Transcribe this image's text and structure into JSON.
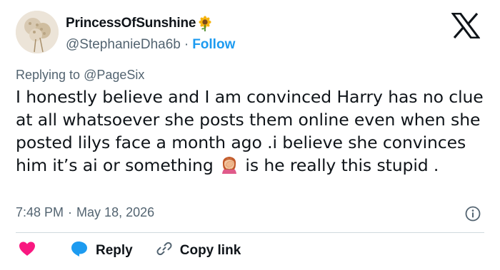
{
  "author": {
    "display_name": "PrincessOfSunshine",
    "handle": "@StephanieDha6b",
    "separator": "·",
    "follow_label": "Follow"
  },
  "reply_context": {
    "prefix": "Replying to",
    "mention": "@PageSix"
  },
  "tweet": {
    "text_part1": "I honestly believe and I am convinced Harry has no clue at all whatsoever she posts them online even when she posted lilys face a month ago .i believe she convinces him it’s ai or something",
    "text_part2": "is he really this stupid ."
  },
  "meta": {
    "time": "7:48 PM",
    "separator": "·",
    "date": "May 18, 2026"
  },
  "actions": {
    "reply_label": "Reply",
    "copy_link_label": "Copy link"
  },
  "colors": {
    "accent": "#1d9bf0",
    "like": "#f91880",
    "text": "#0f1419",
    "muted": "#536471"
  },
  "icons": [
    "avatar-image",
    "sunflower-emoji",
    "x-logo-icon",
    "facepalm-emoji",
    "info-icon",
    "heart-icon",
    "reply-bubble-icon",
    "link-icon"
  ]
}
